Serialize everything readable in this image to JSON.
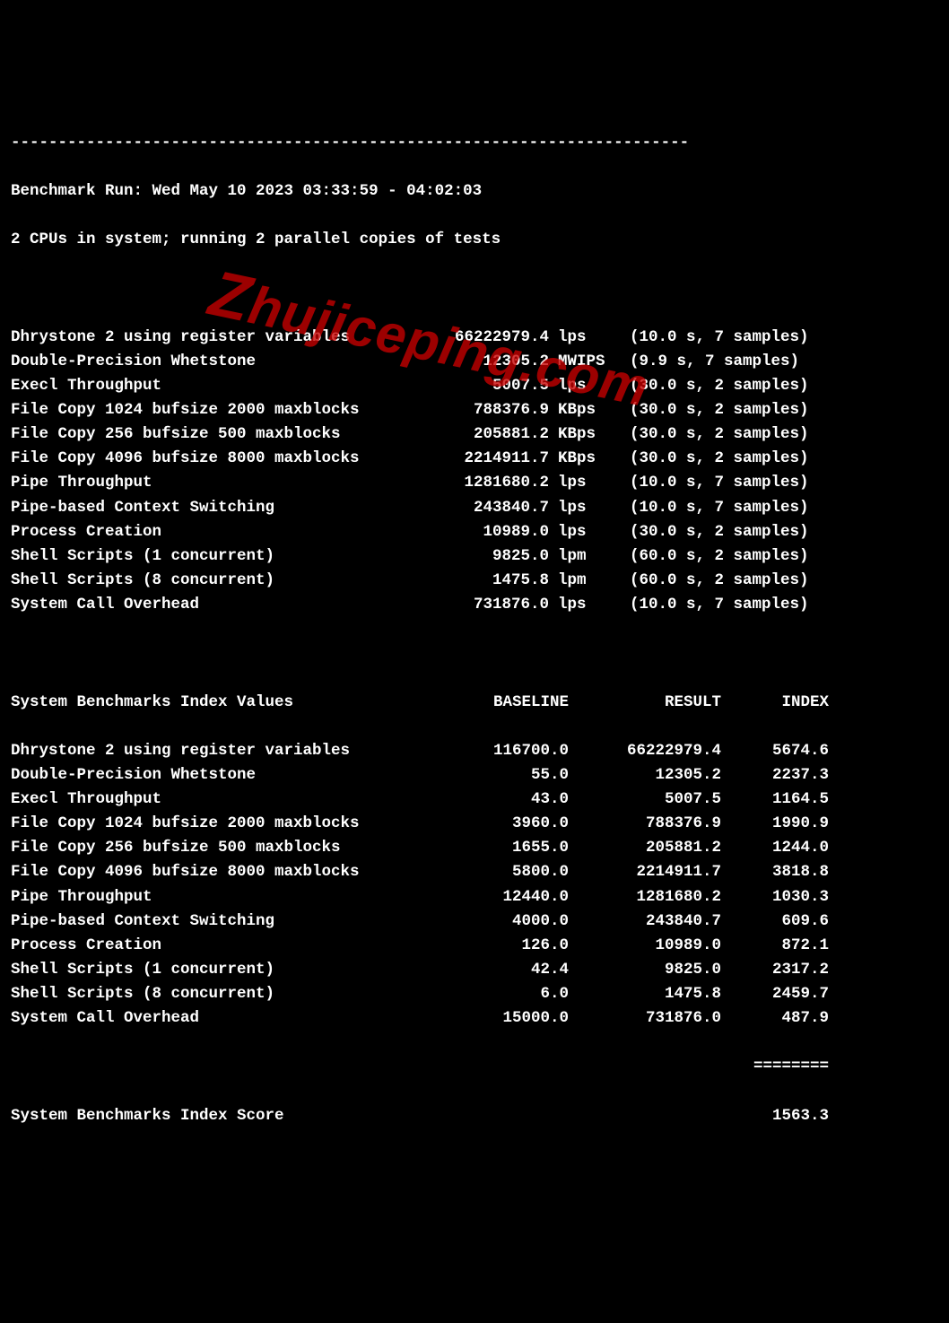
{
  "watermark": "zhujiceping.com",
  "dashes": "------------------------------------------------------------------------",
  "header": {
    "run_line": "Benchmark Run: Wed May 10 2023 03:33:59 - 04:02:03",
    "cpu_line": "2 CPUs in system; running 2 parallel copies of tests"
  },
  "tests": [
    {
      "name": "Dhrystone 2 using register variables",
      "value": "66222979.4",
      "unit": "lps",
      "samples": "(10.0 s, 7 samples)"
    },
    {
      "name": "Double-Precision Whetstone",
      "value": "12305.2",
      "unit": "MWIPS",
      "samples": "(9.9 s, 7 samples)"
    },
    {
      "name": "Execl Throughput",
      "value": "5007.5",
      "unit": "lps",
      "samples": "(30.0 s, 2 samples)"
    },
    {
      "name": "File Copy 1024 bufsize 2000 maxblocks",
      "value": "788376.9",
      "unit": "KBps",
      "samples": "(30.0 s, 2 samples)"
    },
    {
      "name": "File Copy 256 bufsize 500 maxblocks",
      "value": "205881.2",
      "unit": "KBps",
      "samples": "(30.0 s, 2 samples)"
    },
    {
      "name": "File Copy 4096 bufsize 8000 maxblocks",
      "value": "2214911.7",
      "unit": "KBps",
      "samples": "(30.0 s, 2 samples)"
    },
    {
      "name": "Pipe Throughput",
      "value": "1281680.2",
      "unit": "lps",
      "samples": "(10.0 s, 7 samples)"
    },
    {
      "name": "Pipe-based Context Switching",
      "value": "243840.7",
      "unit": "lps",
      "samples": "(10.0 s, 7 samples)"
    },
    {
      "name": "Process Creation",
      "value": "10989.0",
      "unit": "lps",
      "samples": "(30.0 s, 2 samples)"
    },
    {
      "name": "Shell Scripts (1 concurrent)",
      "value": "9825.0",
      "unit": "lpm",
      "samples": "(60.0 s, 2 samples)"
    },
    {
      "name": "Shell Scripts (8 concurrent)",
      "value": "1475.8",
      "unit": "lpm",
      "samples": "(60.0 s, 2 samples)"
    },
    {
      "name": "System Call Overhead",
      "value": "731876.0",
      "unit": "lps",
      "samples": "(10.0 s, 7 samples)"
    }
  ],
  "index_header": {
    "title": "System Benchmarks Index Values",
    "baseline": "BASELINE",
    "result": "RESULT",
    "index": "INDEX"
  },
  "indexes": [
    {
      "name": "Dhrystone 2 using register variables",
      "baseline": "116700.0",
      "result": "66222979.4",
      "index": "5674.6"
    },
    {
      "name": "Double-Precision Whetstone",
      "baseline": "55.0",
      "result": "12305.2",
      "index": "2237.3"
    },
    {
      "name": "Execl Throughput",
      "baseline": "43.0",
      "result": "5007.5",
      "index": "1164.5"
    },
    {
      "name": "File Copy 1024 bufsize 2000 maxblocks",
      "baseline": "3960.0",
      "result": "788376.9",
      "index": "1990.9"
    },
    {
      "name": "File Copy 256 bufsize 500 maxblocks",
      "baseline": "1655.0",
      "result": "205881.2",
      "index": "1244.0"
    },
    {
      "name": "File Copy 4096 bufsize 8000 maxblocks",
      "baseline": "5800.0",
      "result": "2214911.7",
      "index": "3818.8"
    },
    {
      "name": "Pipe Throughput",
      "baseline": "12440.0",
      "result": "1281680.2",
      "index": "1030.3"
    },
    {
      "name": "Pipe-based Context Switching",
      "baseline": "4000.0",
      "result": "243840.7",
      "index": "609.6"
    },
    {
      "name": "Process Creation",
      "baseline": "126.0",
      "result": "10989.0",
      "index": "872.1"
    },
    {
      "name": "Shell Scripts (1 concurrent)",
      "baseline": "42.4",
      "result": "9825.0",
      "index": "2317.2"
    },
    {
      "name": "Shell Scripts (8 concurrent)",
      "baseline": "6.0",
      "result": "1475.8",
      "index": "2459.7"
    },
    {
      "name": "System Call Overhead",
      "baseline": "15000.0",
      "result": "731876.0",
      "index": "487.9"
    }
  ],
  "divider": "========",
  "score": {
    "label": "System Benchmarks Index Score",
    "value": "1563.3"
  }
}
